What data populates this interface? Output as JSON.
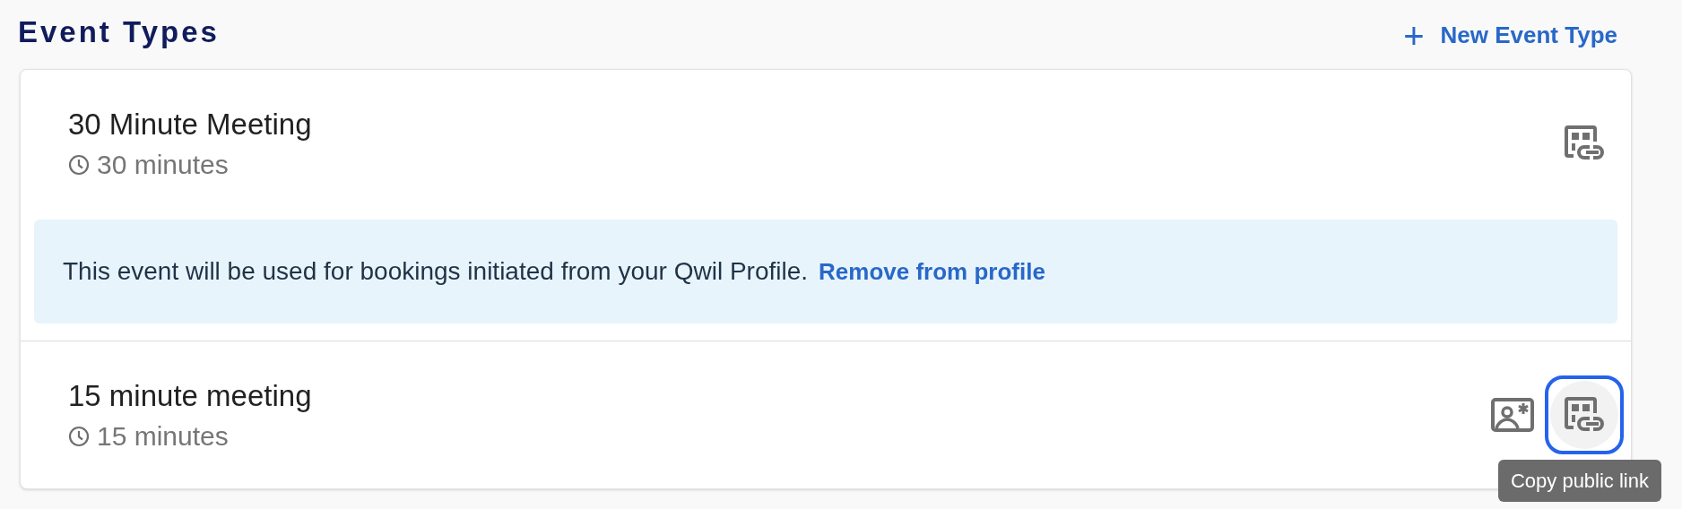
{
  "header": {
    "title": "Event Types",
    "new_button": {
      "icon": "+",
      "label": "New Event Type"
    }
  },
  "events": [
    {
      "name": "30 Minute Meeting",
      "duration": "30 minutes",
      "profile_notice": {
        "text": "This event will be used for bookings initiated from your Qwil Profile.",
        "link": "Remove from profile"
      },
      "set_profile_button": false,
      "copy_link_focused": false
    },
    {
      "name": "15 minute meeting",
      "duration": "15 minutes",
      "set_profile_button": true,
      "copy_link_focused": true,
      "tooltip": "Copy public link"
    }
  ]
}
